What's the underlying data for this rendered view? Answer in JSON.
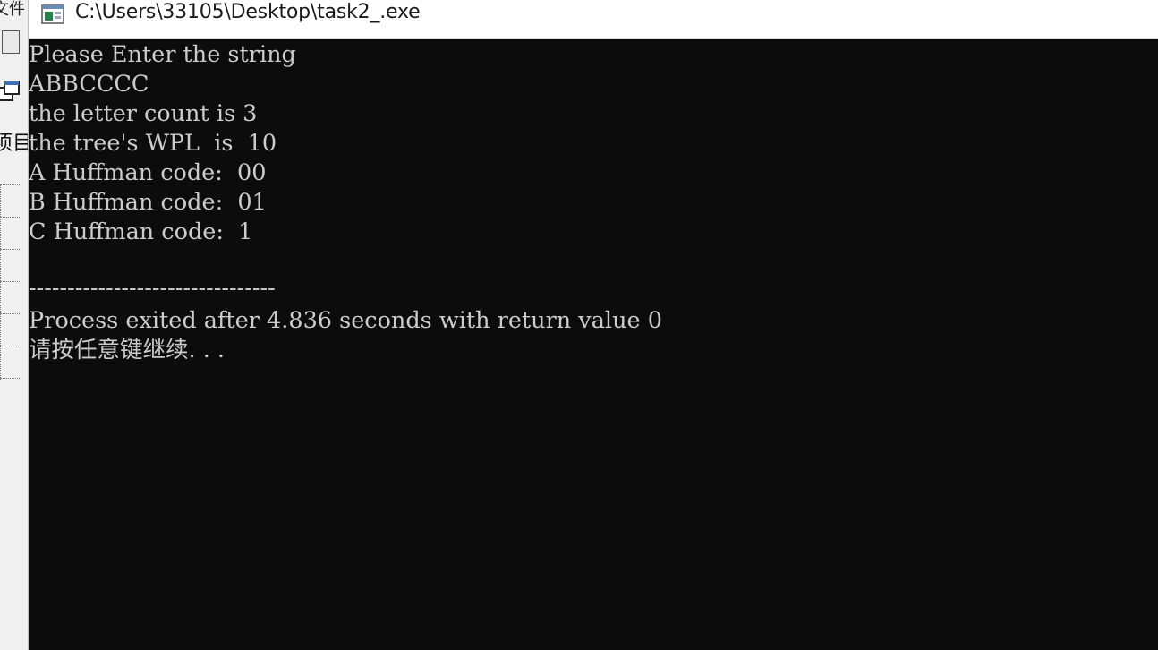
{
  "ide": {
    "menu_fragment": "文件",
    "tab_fragment": "项目"
  },
  "window": {
    "title": "C:\\Users\\33105\\Desktop\\task2_.exe",
    "icon": "console-app-icon"
  },
  "console": {
    "lines": [
      "Please Enter the string",
      "ABBCCCC",
      "the letter count is 3",
      "the tree's WPL  is  10",
      "A Huffman code:  00",
      "B Huffman code:  01",
      "C Huffman code:  1",
      "",
      "--------------------------------",
      "Process exited after 4.836 seconds with return value 0",
      "请按任意键继续. . ."
    ]
  },
  "colors": {
    "console_background": "#0c0c0c",
    "console_text": "#cccccc",
    "title_bar": "#ffffff"
  }
}
